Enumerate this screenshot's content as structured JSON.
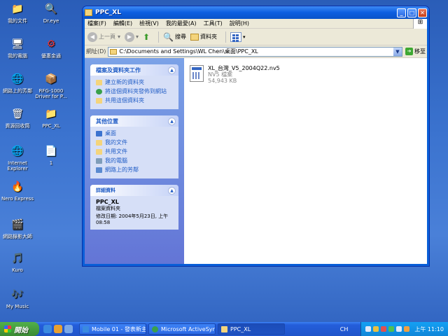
{
  "desktop": {
    "icons": [
      {
        "label": "我的文件",
        "icon": "my-documents-icon"
      },
      {
        "label": "Dr.eye",
        "icon": "dreye-icon"
      },
      {
        "label": "我的電腦",
        "icon": "my-computer-icon"
      },
      {
        "label": "優惠金通",
        "icon": "app-icon"
      },
      {
        "label": "網路上的芳鄰",
        "icon": "network-icon"
      },
      {
        "label": "RFG-1000 Driver for P...",
        "icon": "archive-icon"
      },
      {
        "label": "資源回收筒",
        "icon": "recycle-bin-icon"
      },
      {
        "label": "PPC_XL",
        "icon": "folder-icon"
      },
      {
        "label": "Internet Explorer",
        "icon": "ie-icon"
      },
      {
        "label": "1",
        "icon": "document-icon"
      },
      {
        "label": "Nero Express",
        "icon": "nero-icon"
      },
      {
        "label": "網路錄影大師",
        "icon": "app-icon"
      },
      {
        "label": "Kuro",
        "icon": "kuro-icon"
      },
      {
        "label": "My Music",
        "icon": "music-icon"
      }
    ]
  },
  "window": {
    "title": "PPC_XL",
    "menu": [
      "檔案(F)",
      "編輯(E)",
      "檢視(V)",
      "我的最愛(A)",
      "工具(T)",
      "說明(H)"
    ],
    "toolbar": {
      "back": "上一頁",
      "search": "搜尋",
      "folders": "資料夾"
    },
    "address": {
      "label": "網址(D)",
      "value": "C:\\Documents and Settings\\WL Chen\\桌面\\PPC_XL",
      "go": "移至"
    },
    "taskpane": {
      "file_tasks": {
        "title": "檔案及資料夾工作",
        "items": [
          "建立新的資料夾",
          "將這個資料夾發佈到網站",
          "共用這個資料夾"
        ]
      },
      "other_places": {
        "title": "其他位置",
        "items": [
          "桌面",
          "我的文件",
          "共用文件",
          "我的電腦",
          "網路上的芳鄰"
        ]
      },
      "details": {
        "title": "詳細資料",
        "name": "PPC_XL",
        "type": "檔案資料夾",
        "modified": "修改日期: 2004年5月23日, 上午",
        "time": "08:58"
      }
    },
    "files": [
      {
        "name": "XL_台灣_V5_2004Q22.nv5",
        "type": "NV5 檔案",
        "size": "54,943 KB"
      }
    ]
  },
  "taskbar": {
    "start": "開始",
    "buttons": [
      "Mobile 01 - 發表新主...",
      "Microsoft ActiveSync",
      "PPC_XL"
    ],
    "lang": "CH",
    "clock": "上午 11:10"
  },
  "colors": {
    "desktop": "#3b73cf",
    "titlebar": "#0c5ee0",
    "taskpane": "#7ba2e7",
    "taskbar": "#245edb",
    "start": "#3a8a33",
    "link": "#215dc6"
  }
}
